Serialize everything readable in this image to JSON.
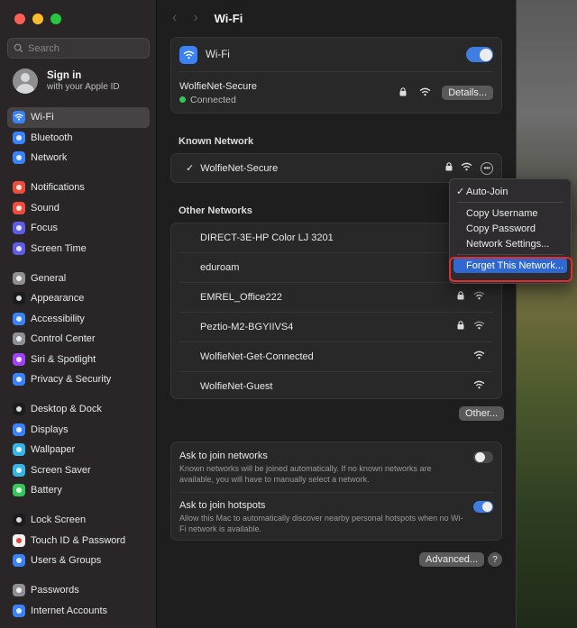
{
  "window": {
    "title": "Wi-Fi"
  },
  "sidebar": {
    "search_placeholder": "Search",
    "signin": {
      "title": "Sign in",
      "subtitle": "with your Apple ID"
    },
    "items": [
      {
        "label": "Wi-Fi",
        "icon": "wifi-icon",
        "color": "#3a82f7",
        "active": true
      },
      {
        "label": "Bluetooth",
        "icon": "bluetooth-icon",
        "color": "#3a82f7"
      },
      {
        "label": "Network",
        "icon": "globe-icon",
        "color": "#3a82f7"
      },
      {
        "label": "Notifications",
        "icon": "bell-icon",
        "color": "#ec4d3d"
      },
      {
        "label": "Sound",
        "icon": "speaker-icon",
        "color": "#ec4d3d"
      },
      {
        "label": "Focus",
        "icon": "moon-icon",
        "color": "#5e5ce6"
      },
      {
        "label": "Screen Time",
        "icon": "hourglass-icon",
        "color": "#5e5ce6"
      },
      {
        "label": "General",
        "icon": "gear-icon",
        "color": "#8e8e93"
      },
      {
        "label": "Appearance",
        "icon": "appearance-icon",
        "color": "#1c1c1e"
      },
      {
        "label": "Accessibility",
        "icon": "accessibility-icon",
        "color": "#3a82f7"
      },
      {
        "label": "Control Center",
        "icon": "control-center-icon",
        "color": "#8e8e93"
      },
      {
        "label": "Siri & Spotlight",
        "icon": "siri-icon",
        "color": "#a142f4"
      },
      {
        "label": "Privacy & Security",
        "icon": "hand-icon",
        "color": "#3a82f7"
      },
      {
        "label": "Desktop & Dock",
        "icon": "dock-icon",
        "color": "#1c1c1e"
      },
      {
        "label": "Displays",
        "icon": "sun-icon",
        "color": "#3a82f7"
      },
      {
        "label": "Wallpaper",
        "icon": "flower-icon",
        "color": "#35b5e5"
      },
      {
        "label": "Screen Saver",
        "icon": "screensaver-icon",
        "color": "#35b5e5"
      },
      {
        "label": "Battery",
        "icon": "battery-icon",
        "color": "#34c759"
      },
      {
        "label": "Lock Screen",
        "icon": "lock-icon",
        "color": "#1c1c1e"
      },
      {
        "label": "Touch ID & Password",
        "icon": "fingerprint-icon",
        "color": "#f2f2f2"
      },
      {
        "label": "Users & Groups",
        "icon": "users-icon",
        "color": "#3a82f7"
      },
      {
        "label": "Passwords",
        "icon": "key-icon",
        "color": "#8e8e93"
      },
      {
        "label": "Internet Accounts",
        "icon": "at-icon",
        "color": "#3a82f7"
      }
    ]
  },
  "wifi": {
    "label": "Wi-Fi",
    "enabled": true,
    "current_network": "WolfieNet-Secure",
    "status": "Connected",
    "details_button": "Details..."
  },
  "known": {
    "title": "Known Network",
    "network": "WolfieNet-Secure",
    "checkmark": "✓"
  },
  "other": {
    "title": "Other Networks",
    "networks": [
      {
        "name": "DIRECT-3E-HP Color LJ 3201",
        "locked": false
      },
      {
        "name": "eduroam",
        "locked": false
      },
      {
        "name": "EMREL_Office222",
        "locked": true
      },
      {
        "name": "Peztio-M2-BGYIIVS4",
        "locked": true
      },
      {
        "name": "WolfieNet-Get-Connected",
        "locked": false
      },
      {
        "name": "WolfieNet-Guest",
        "locked": false
      }
    ],
    "other_button": "Other..."
  },
  "ask_join": {
    "title": "Ask to join networks",
    "desc": "Known networks will be joined automatically. If no known networks are available, you will have to manually select a network.",
    "enabled": false
  },
  "ask_hotspots": {
    "title": "Ask to join hotspots",
    "desc": "Allow this Mac to automatically discover nearby personal hotspots when no Wi-Fi network is available.",
    "enabled": true
  },
  "footer": {
    "advanced_button": "Advanced...",
    "help_label": "?"
  },
  "context_menu": {
    "auto_join": "Auto-Join",
    "auto_join_check": "✓",
    "copy_username": "Copy Username",
    "copy_password": "Copy Password",
    "network_settings": "Network Settings...",
    "forget": "Forget This Network..."
  }
}
